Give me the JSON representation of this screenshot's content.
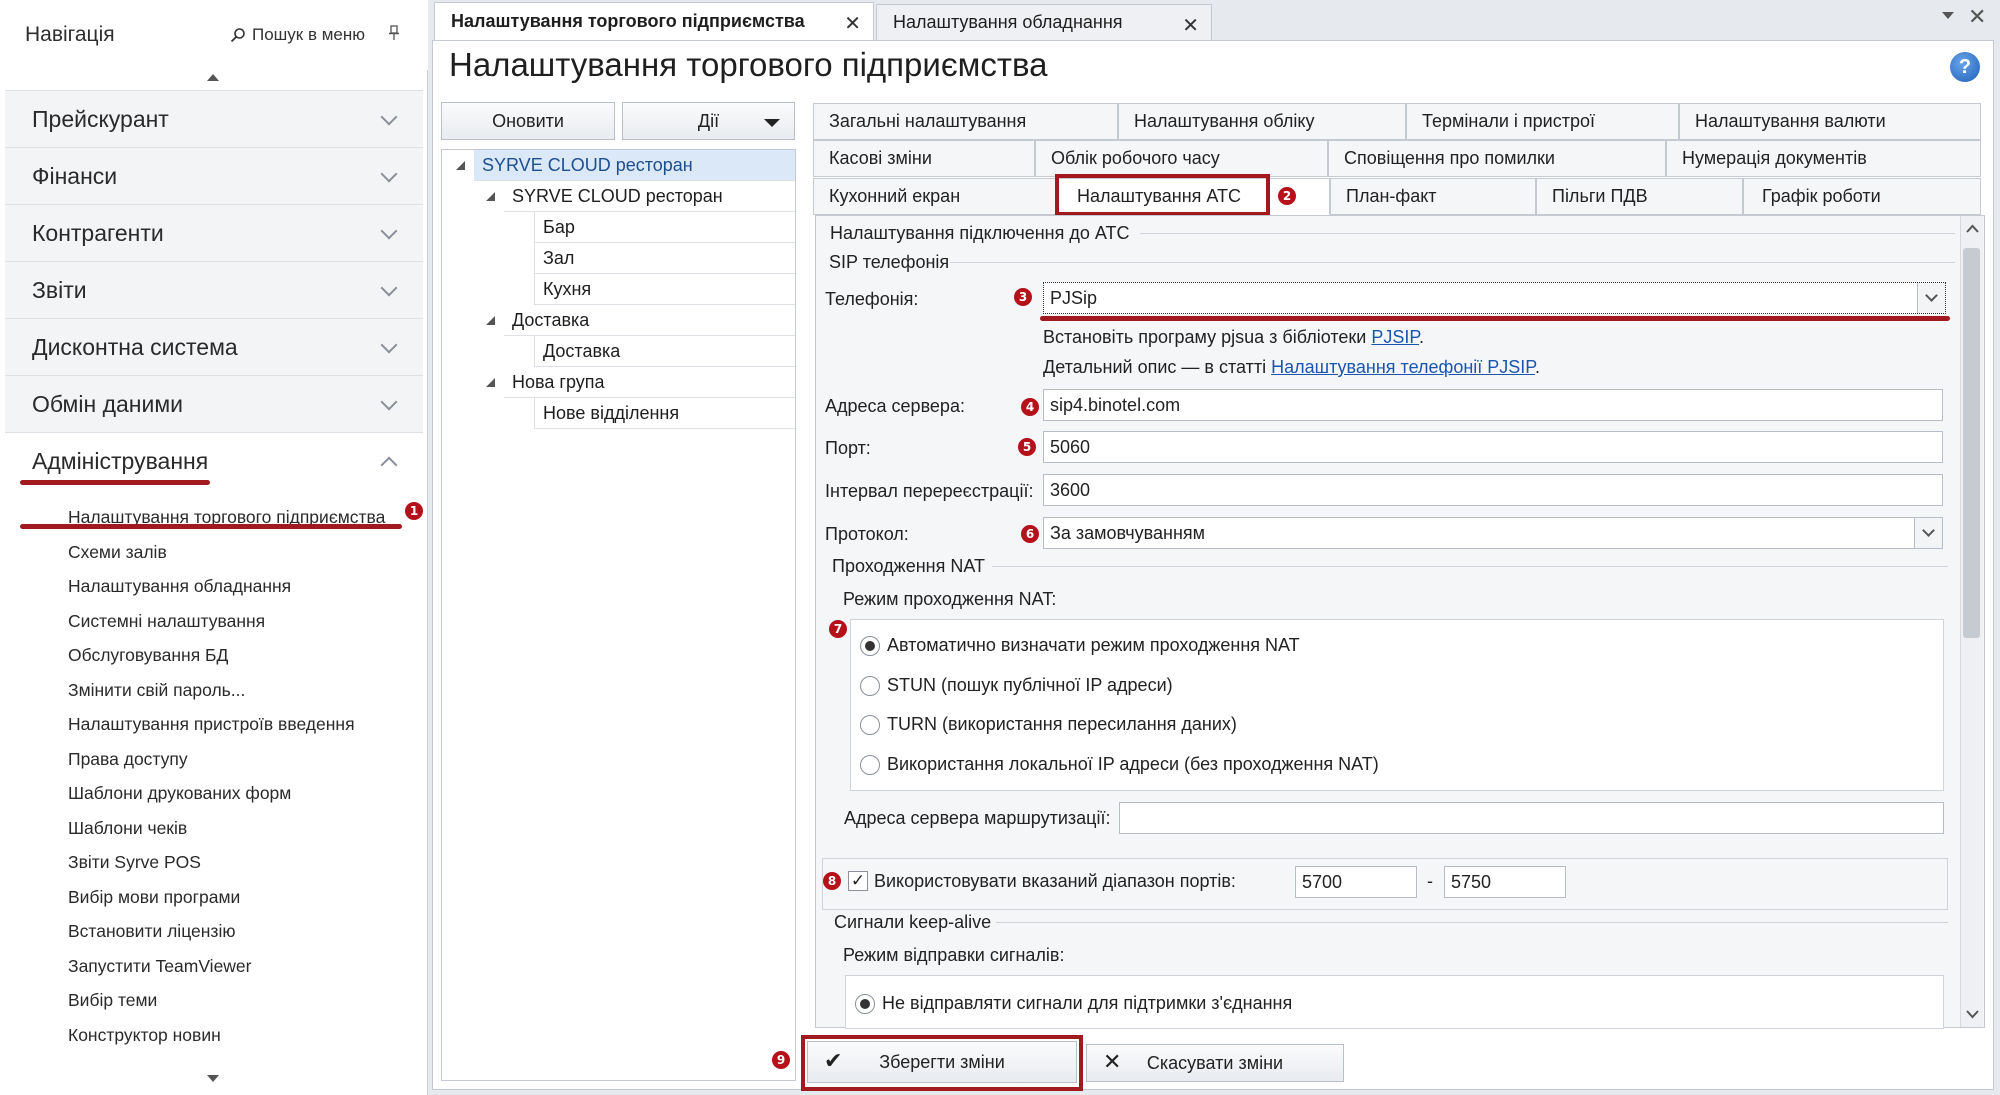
{
  "nav": {
    "title": "Навігація",
    "search_label": "Пошук в меню",
    "sections": [
      {
        "label": "Прейскурант"
      },
      {
        "label": "Фінанси"
      },
      {
        "label": "Контрагенти"
      },
      {
        "label": "Звіти"
      },
      {
        "label": "Дисконтна система"
      },
      {
        "label": "Обмін даними"
      },
      {
        "label": "Адміністрування"
      }
    ],
    "admin_items": [
      "Налаштування торгового підприємства",
      "Схеми залів",
      "Налаштування обладнання",
      "Системні налаштування",
      "Обслуговування БД",
      "Змінити свій пароль...",
      "Налаштування пристроїв введення",
      "Права доступу",
      "Шаблони друкованих форм",
      "Шаблони чеків",
      "Звіти Syrve POS",
      "Вибір мови програми",
      "Встановити ліцензію",
      "Запустити TeamViewer",
      "Вибір теми",
      "Конструктор новин"
    ]
  },
  "doc_tabs": [
    {
      "label": "Налаштування торгового підприємства"
    },
    {
      "label": "Налаштування обладнання"
    }
  ],
  "page_title": "Налаштування торгового підприємства",
  "tree_toolbar": {
    "refresh": "Оновити",
    "actions": "Дії"
  },
  "tree": [
    "SYRVE CLOUD ресторан",
    "SYRVE CLOUD ресторан",
    "Бар",
    "Зал",
    "Кухня",
    "Доставка",
    "Доставка",
    "Нова група",
    "Нове відділення"
  ],
  "settings_tabs": {
    "row1": [
      "Загальні налаштування",
      "Налаштування обліку",
      "Термінали і пристрої",
      "Налаштування валюти"
    ],
    "row2": [
      "Касові зміни",
      "Облік робочого часу",
      "Сповіщення про помилки",
      "Нумерація документів"
    ],
    "row3": [
      "Кухонний екран",
      "Налаштування АТС",
      "План-факт",
      "Пільги ПДВ",
      "Графік роботи"
    ]
  },
  "form": {
    "group_title": "Налаштування підключення до АТС",
    "sip_title": "SIP телефонія",
    "telephony_label": "Телефонія:",
    "telephony_value": "PJSip",
    "hint1_text": "Встановіть програму pjsua з бібліотеки ",
    "hint1_link": "PJSIP",
    "hint1_end": ".",
    "hint2_text": "Детальний опис — в статті ",
    "hint2_link": "Налаштування телефонії PJSIP",
    "hint2_end": ".",
    "server_label": "Адреса сервера:",
    "server_value": "sip4.binotel.com",
    "port_label": "Порт:",
    "port_value": "5060",
    "rereg_label": "Інтервал перереєстрації:",
    "rereg_value": "3600",
    "protocol_label": "Протокол:",
    "protocol_value": "За замовчуванням",
    "nat_title": "Проходження NAT",
    "nat_mode_label": "Режим проходження NAT:",
    "nat_options": [
      {
        "label": "Автоматично визначати режим проходження NAT",
        "selected": true
      },
      {
        "label": "STUN (пошук публічної IP адреси)",
        "selected": false
      },
      {
        "label": "TURN (використання пересилання даних)",
        "selected": false
      },
      {
        "label": "Використання локальної IP адреси (без проходження NAT)",
        "selected": false
      }
    ],
    "routing_label": "Адреса сервера маршрутизації:",
    "routing_value": "",
    "ports_label": "Використовувати вказаний діапазон портів:",
    "ports_checked": true,
    "port_from": "5700",
    "port_dash": "-",
    "port_to": "5750",
    "keepalive_title": "Сигнали keep-alive",
    "keepalive_mode_label": "Режим відправки сигналів:",
    "keepalive_option": "Не відправляти сигнали для підтримки з'єднання"
  },
  "buttons": {
    "save": "Зберегти зміни",
    "cancel": "Скасувати зміни"
  },
  "badges": [
    "1",
    "2",
    "3",
    "4",
    "5",
    "6",
    "7",
    "8",
    "9"
  ],
  "colors": {
    "highlight": "#a11a1f",
    "badge": "#b5111b",
    "link": "#1a55b0",
    "selection": "#dbe8f8"
  }
}
